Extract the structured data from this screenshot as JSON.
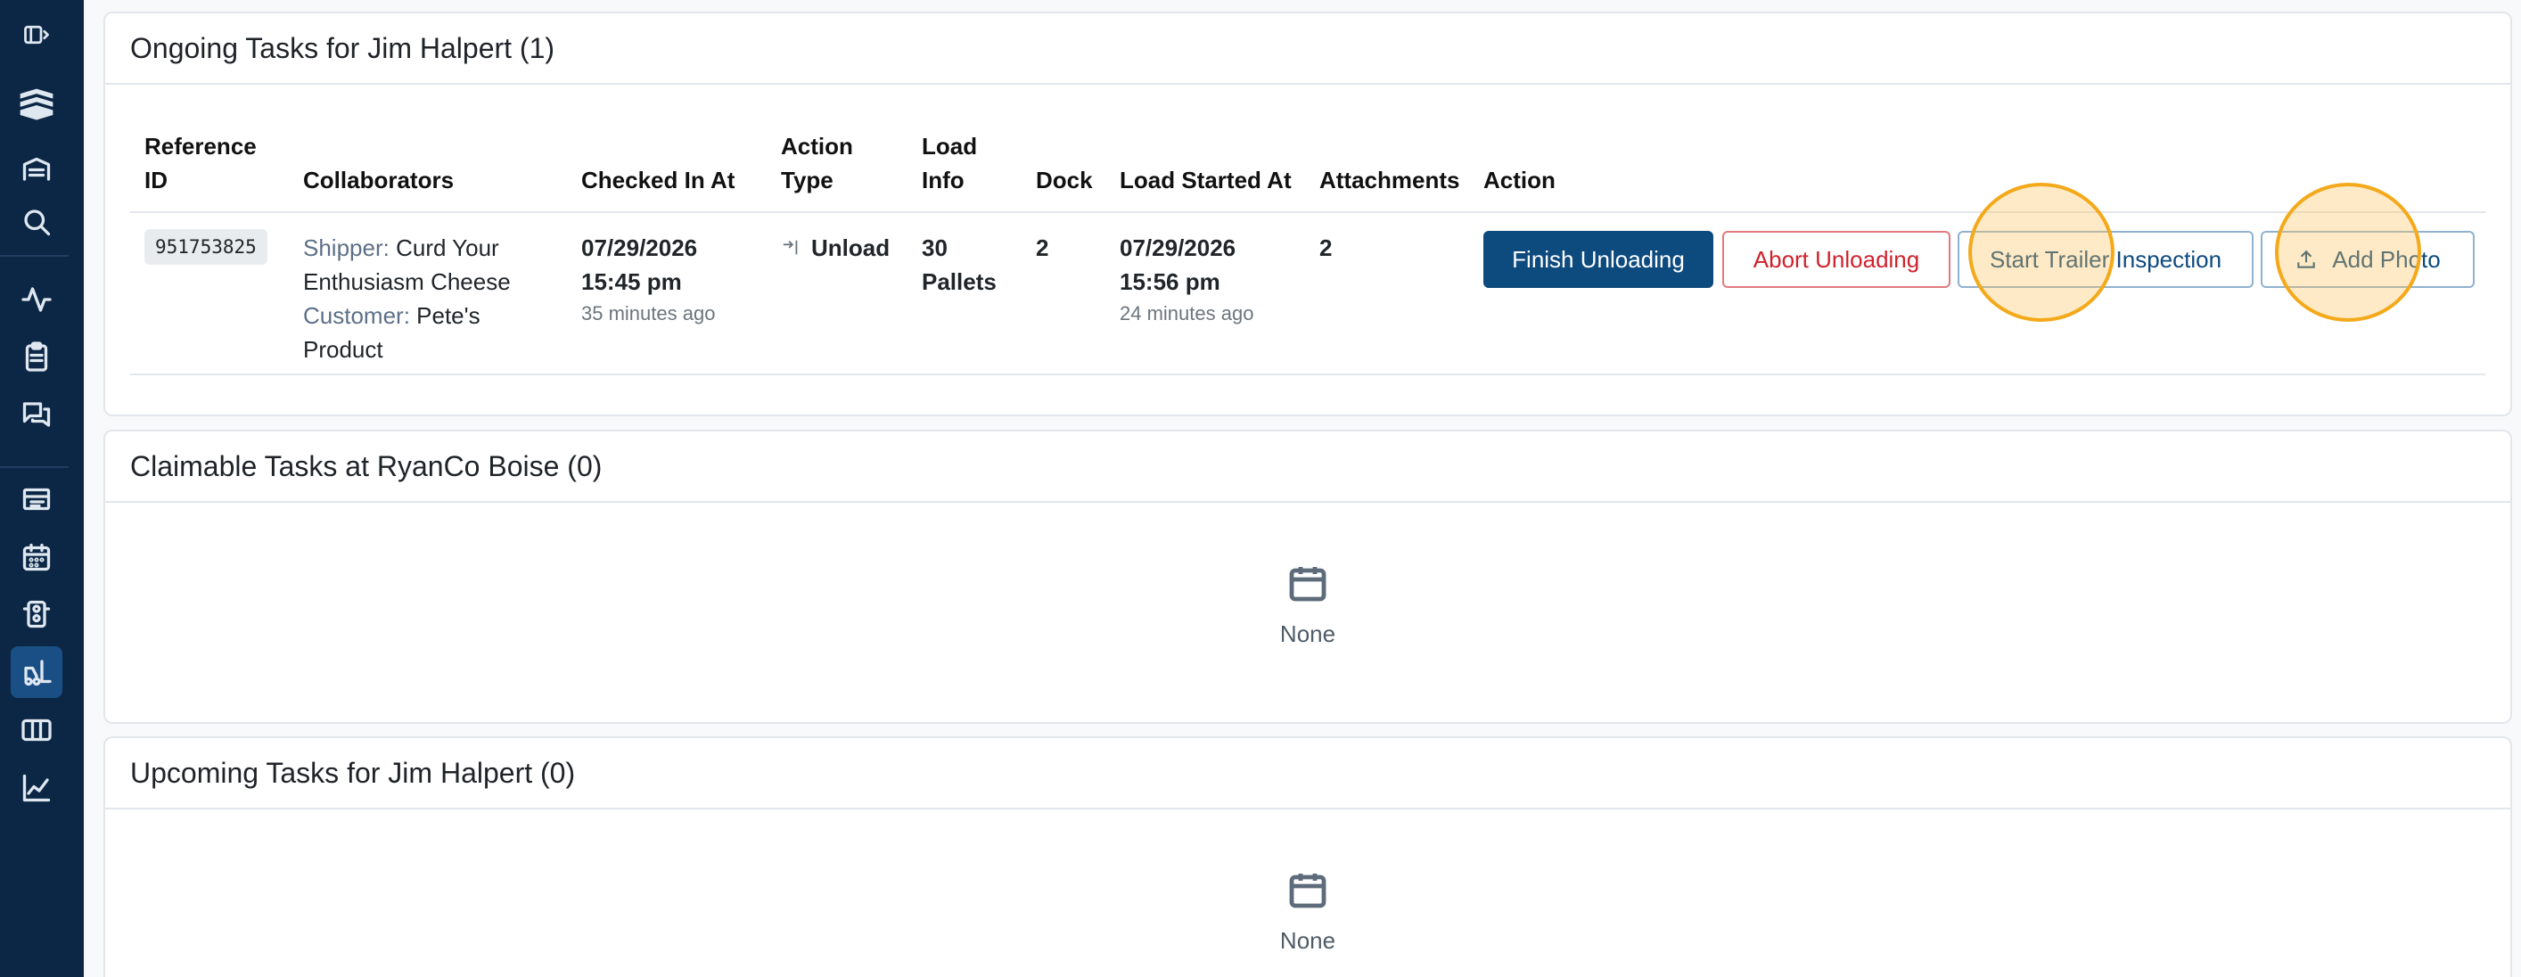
{
  "sidebar": {
    "items": [
      {
        "name": "toggle-sidebar-icon"
      },
      {
        "name": "logo-icon"
      },
      {
        "name": "warehouse-icon"
      },
      {
        "name": "search-icon"
      },
      {
        "name": "activity-icon"
      },
      {
        "name": "clipboard-icon"
      },
      {
        "name": "messages-icon"
      },
      {
        "name": "appointments-icon"
      },
      {
        "name": "calendar-icon"
      },
      {
        "name": "dock-icon"
      },
      {
        "name": "forklift-icon"
      },
      {
        "name": "map-icon"
      },
      {
        "name": "analytics-icon"
      }
    ],
    "active": "forklift-icon"
  },
  "ongoing": {
    "title": "Ongoing Tasks for Jim Halpert (1)",
    "columns": {
      "reference_id_line1": "Reference",
      "reference_id_line2": "ID",
      "collaborators": "Collaborators",
      "checked_in_at": "Checked In At",
      "action_type_line1": "Action",
      "action_type_line2": "Type",
      "load_info_line1": "Load",
      "load_info_line2": "Info",
      "dock": "Dock",
      "load_started_at": "Load Started At",
      "attachments": "Attachments",
      "action": "Action"
    },
    "row": {
      "reference_id": "951753825",
      "shipper_label": "Shipper:",
      "shipper_line1": "Curd Your",
      "shipper_line2": "Enthusiasm Cheese",
      "customer_label": "Customer:",
      "customer_line1": "Pete's",
      "customer_line2": "Product",
      "checked_in_date": "07/29/2026",
      "checked_in_time": "15:45 pm",
      "checked_in_relative": "35 minutes ago",
      "action_type": "Unload",
      "load_info_line1": "30",
      "load_info_line2": "Pallets",
      "dock": "2",
      "load_started_date": "07/29/2026",
      "load_started_time": "15:56 pm",
      "load_started_relative": "24 minutes ago",
      "attachments": "2"
    },
    "buttons": {
      "finish": "Finish Unloading",
      "abort": "Abort Unloading",
      "inspection": "Start Trailer Inspection",
      "add_photo": "Add Photo"
    }
  },
  "claimable": {
    "title": "Claimable Tasks at RyanCo Boise (0)",
    "empty": "None"
  },
  "upcoming": {
    "title": "Upcoming Tasks for Jim Halpert (0)",
    "empty": "None"
  },
  "colors": {
    "sidebar_bg": "#0b2745",
    "primary": "#0d4a7e",
    "danger": "#d0212c",
    "highlight": "#f4a91a"
  }
}
